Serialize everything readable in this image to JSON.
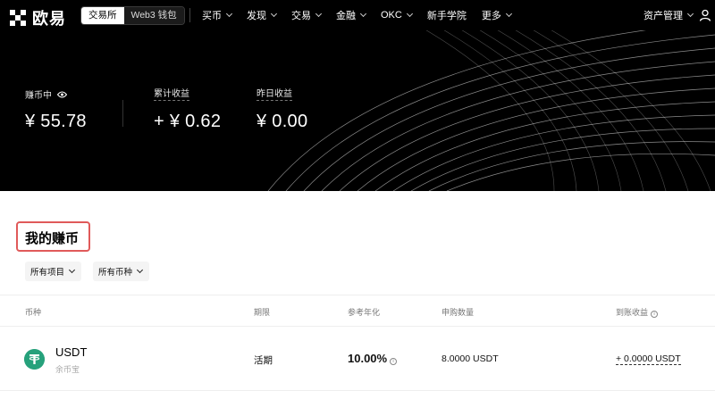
{
  "nav": {
    "logo_text": "欧易",
    "switch": [
      "交易所",
      "Web3 钱包"
    ],
    "menu": [
      "买币",
      "发现",
      "交易",
      "金融",
      "OKC",
      "新手学院",
      "更多"
    ],
    "assets_label": "资产管理",
    "icons": [
      "logo-icon",
      "chevron-down-icon",
      "user-icon"
    ]
  },
  "hero": {
    "earning_label": "赚币中",
    "earning_value": "¥ 55.78",
    "cumulative_label": "累计收益",
    "cumulative_value": "+ ¥ 0.62",
    "yesterday_label": "昨日收益",
    "yesterday_value": "¥ 0.00"
  },
  "main": {
    "title": "我的赚币",
    "filters": [
      "所有项目",
      "所有币种"
    ]
  },
  "table": {
    "headers": [
      "币种",
      "期限",
      "参考年化",
      "申购数量",
      "到账收益"
    ],
    "rows": [
      {
        "coin": "USDT",
        "product": "余币宝",
        "term": "活期",
        "apy": "10.00%",
        "amount": "8.0000 USDT",
        "earnings": "+ 0.0000 USDT"
      }
    ]
  },
  "colors": {
    "nav_bg": "#000000",
    "hero_bg": "#000000",
    "highlight_box": "#e05a5a",
    "usdt_green": "#26a17b"
  }
}
